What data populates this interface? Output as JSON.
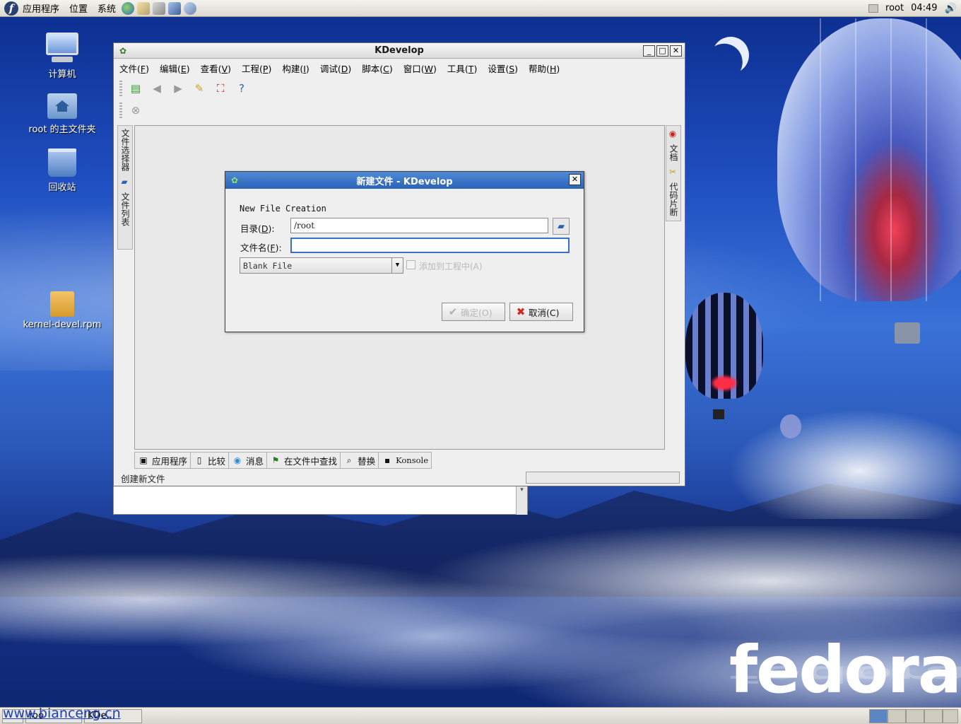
{
  "top_panel": {
    "menus": [
      "应用程序",
      "位置",
      "系统"
    ],
    "user": "root",
    "clock": "04:49"
  },
  "desktop_icons": [
    {
      "label": "计算机"
    },
    {
      "label": "root 的主文件夹"
    },
    {
      "label": "回收站"
    },
    {
      "label": "kernel-devel.rpm"
    }
  ],
  "main_window": {
    "title": "KDevelop",
    "menu": [
      {
        "text": "文件(",
        "key": "F",
        "end": ")"
      },
      {
        "text": "编辑(",
        "key": "E",
        "end": ")"
      },
      {
        "text": "查看(",
        "key": "V",
        "end": ")"
      },
      {
        "text": "工程(",
        "key": "P",
        "end": ")"
      },
      {
        "text": "构建(",
        "key": "I",
        "end": ")"
      },
      {
        "text": "调试(",
        "key": "D",
        "end": ")"
      },
      {
        "text": "脚本(",
        "key": "C",
        "end": ")"
      },
      {
        "text": "窗口(",
        "key": "W",
        "end": ")"
      },
      {
        "text": "工具(",
        "key": "T",
        "end": ")"
      },
      {
        "text": "设置(",
        "key": "S",
        "end": ")"
      },
      {
        "text": "帮助(",
        "key": "H",
        "end": ")"
      }
    ],
    "left_dock_tabs": [
      "文件选择器",
      "文件列表"
    ],
    "right_dock_tabs": [
      "文档",
      "代码片断"
    ],
    "bottom_tabs": [
      "应用程序",
      "比较",
      "消息",
      "在文件中查找",
      "替换",
      "Konsole"
    ],
    "status_text": "创建新文件"
  },
  "dialog": {
    "title": "新建文件 - KDevelop",
    "heading": "New File Creation",
    "dir_label": "目录(",
    "dir_key": "D",
    "dir_end": "):",
    "dir_value": "/root",
    "name_label": "文件名(",
    "name_key": "F",
    "name_end": "):",
    "name_value": "",
    "template_selected": "Blank File",
    "add_to_project_label": "添加到工程中(A)",
    "ok_label": "确定(O)",
    "cancel_label": "取消(C)"
  },
  "taskbar": {
    "tasks": [
      "roo",
      "KDe..."
    ],
    "watermark": "www.bianceng.cn"
  },
  "wallpaper_logo": "fedora"
}
